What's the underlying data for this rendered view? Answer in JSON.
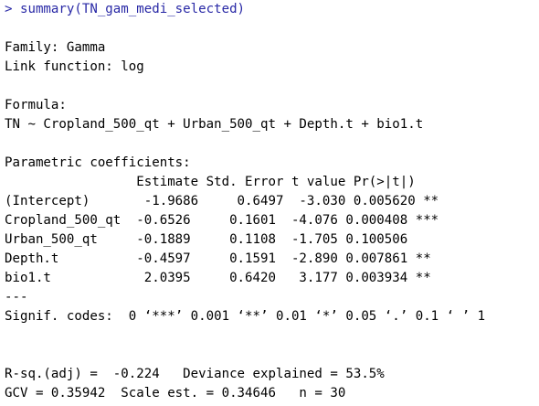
{
  "console": {
    "lines": [
      "> summary(TN_gam_medi_selected)",
      "",
      "Family: Gamma",
      "Link function: log",
      "",
      "Formula:",
      "TN ~ Cropland_500_qt + Urban_500_qt + Depth.t + bio1.t",
      "",
      "Parametric coefficients:",
      "                 Estimate Std. Error t value Pr(>|t|)",
      "(Intercept)       -1.9686     0.6497  -3.030 0.005620 **",
      "Cropland_500_qt  -0.6526     0.1601  -4.076 0.000408 ***",
      "Urban_500_qt     -0.1889     0.1108  -1.705 0.100506",
      "Depth.t          -0.4597     0.1591  -2.890 0.007861 **",
      "bio1.t            2.0395     0.6420   3.177 0.003934 **",
      "---",
      "Signif. codes:  0 ‘***’ 0.001 ‘**’ 0.01 ‘*’ 0.05 ‘.’ 0.1 ‘ ’ 1",
      "",
      "",
      "R-sq.(adj) =  -0.224   Deviance explained = 53.5%",
      "GCV = 0.35942  Scale est. = 0.34646   n = 30"
    ],
    "command_color": "#2929a6",
    "text_color": "#000000"
  }
}
